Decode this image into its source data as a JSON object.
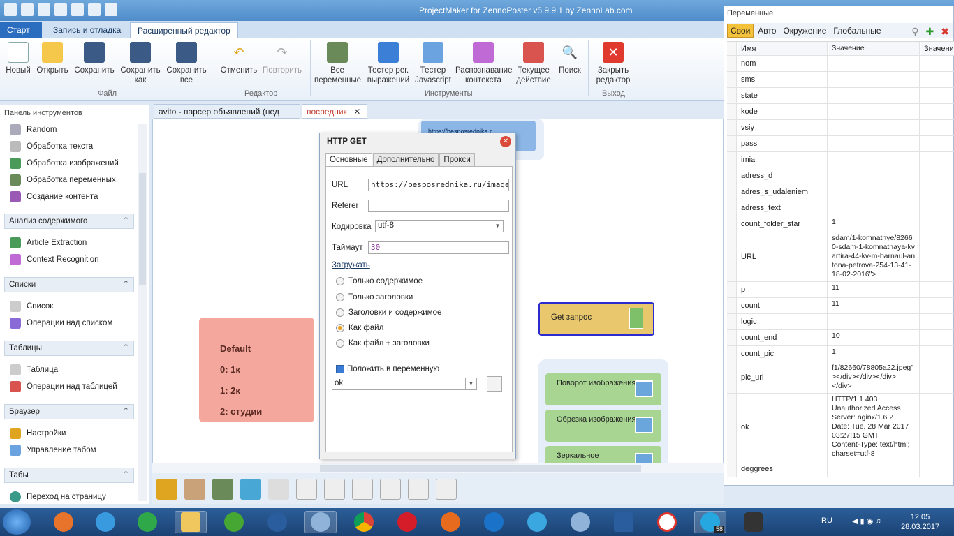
{
  "window": {
    "title": "ProjectMaker for ZennoPoster v5.9.9.1 by ZennoLab.com"
  },
  "main_tabs": [
    "Старт",
    "Запись и отладка",
    "Расширенный редактор"
  ],
  "ribbon": {
    "file": {
      "label": "Файл",
      "buttons": [
        "Новый",
        "Открыть",
        "Сохранить",
        "Сохранить как",
        "Сохранить все"
      ]
    },
    "editor": {
      "label": "Редактор",
      "buttons": [
        "Отменить",
        "Повторить"
      ]
    },
    "tools": {
      "label": "Инструменты",
      "buttons": [
        "Все переменные",
        "Тестер рег. выражений",
        "Тестер Javascript",
        "Распознавание контекста",
        "Текущее действие",
        "Поиск"
      ]
    },
    "exit": {
      "label": "Выход",
      "buttons": [
        "Закрыть редактор"
      ]
    }
  },
  "left_panel": {
    "title": "Панель инструментов",
    "top_items": [
      "Random",
      "Обработка текста",
      "Обработка изображений",
      "Обработка переменных",
      "Создание контента"
    ],
    "sections": [
      {
        "title": "Анализ содержимого",
        "items": [
          "Article Extraction",
          "Context Recognition"
        ]
      },
      {
        "title": "Списки",
        "items": [
          "Список",
          "Операции над списком"
        ]
      },
      {
        "title": "Таблицы",
        "items": [
          "Таблица",
          "Операции над таблицей"
        ]
      },
      {
        "title": "Браузер",
        "items": [
          "Настройки",
          "Управление табом"
        ]
      },
      {
        "title": "Табы",
        "items": [
          "Переход на страницу"
        ]
      }
    ]
  },
  "doc_tabs": [
    "avito - парсер объявлений (нед",
    "посредник"
  ],
  "canvas": {
    "default_block": [
      "Default",
      "0: 1к",
      "1: 2к",
      "2: студии"
    ],
    "url_block": "https://besposrednika.r",
    "get_block": "Get запрос",
    "green_blocks": [
      "Поворот изображения",
      "Обрезка изображения",
      "Зеркальное"
    ]
  },
  "dialog": {
    "title": "HTTP GET",
    "tabs": [
      "Основные",
      "Дополнительно",
      "Прокси"
    ],
    "url_label": "URL",
    "url_value": "https://besposrednika.ru/images",
    "referer_label": "Referer",
    "referer_value": "",
    "encoding_label": "Кодировка",
    "encoding_value": "utf-8",
    "timeout_label": "Таймаут",
    "timeout_value": "30",
    "load_label": "Загружать",
    "radio_options": [
      "Только содержимое",
      "Только заголовки",
      "Заголовки и содержимое",
      "Как файл",
      "Как файл + заголовки"
    ],
    "radio_selected": 3,
    "save_var_label": "Положить в переменную",
    "save_var_value": "ok"
  },
  "variables_panel": {
    "title": "Переменные",
    "tabs": [
      "Свои",
      "Авто",
      "Окружение",
      "Глобальные"
    ],
    "headers": [
      "Имя",
      "Значение",
      "Значение"
    ],
    "rows": [
      {
        "name": "nom",
        "value": ""
      },
      {
        "name": "sms",
        "value": ""
      },
      {
        "name": "state",
        "value": ""
      },
      {
        "name": "kode",
        "value": ""
      },
      {
        "name": "vsiy",
        "value": ""
      },
      {
        "name": "pass",
        "value": ""
      },
      {
        "name": "imia",
        "value": ""
      },
      {
        "name": "adress_d",
        "value": ""
      },
      {
        "name": "adres_s_udaleniem",
        "value": ""
      },
      {
        "name": "adress_text",
        "value": ""
      },
      {
        "name": "count_folder_star",
        "value": "1"
      },
      {
        "name": "URL",
        "value": "sdam/1-komnatnye/8266\n0-sdam-1-komnatnaya-kv\nartira-44-kv-m-barnaul-an\ntona-petrova-254-13-41-\n18-02-2016\">"
      },
      {
        "name": "p",
        "value": "11"
      },
      {
        "name": "count",
        "value": "11"
      },
      {
        "name": "logic",
        "value": ""
      },
      {
        "name": "count_end",
        "value": "10"
      },
      {
        "name": "count_pic",
        "value": "1"
      },
      {
        "name": "pic_url",
        "value": "f1/82660/78805a22.jpeg\"\n></div></div></div>\n</div>"
      },
      {
        "name": "ok",
        "value": "HTTP/1.1 403\nUnauthorized Access\nServer: nginx/1.6.2\nDate: Tue, 28 Mar 2017\n03:27:15 GMT\nContent-Type: text/html;\ncharset=utf-8"
      },
      {
        "name": "deggrees",
        "value": ""
      }
    ]
  },
  "taskbar": {
    "lang": "RU",
    "time": "12:05",
    "date": "28.03.2017",
    "skype_badge": "58"
  },
  "colors": {
    "accent": "#2b6dbf",
    "default_block": "#f4a79d",
    "get_block": "#e9c86d",
    "green_block": "#a8d592",
    "active_var_tab": "#f4c13a"
  }
}
